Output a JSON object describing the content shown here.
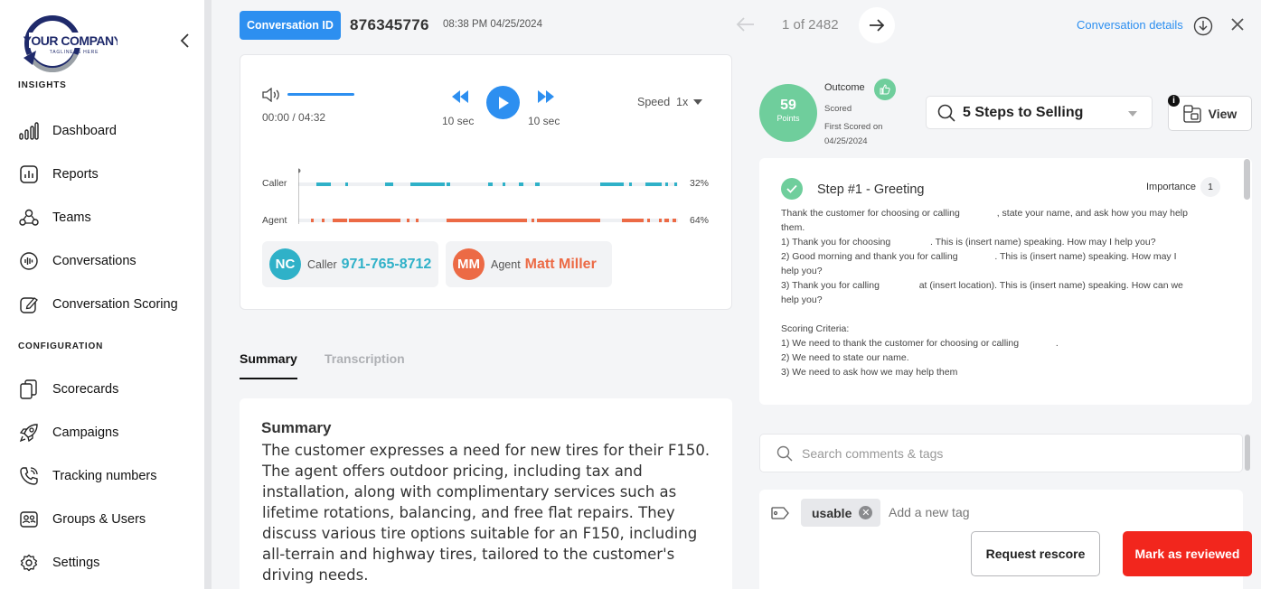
{
  "brand": {
    "logo_text": "YOUR COMPANY",
    "logo_tagline": "TAGLINE IS HERE"
  },
  "sidebar": {
    "sections": [
      {
        "label": "INSIGHTS",
        "items": [
          {
            "label": "Dashboard",
            "icon": "bar-chart-icon"
          },
          {
            "label": "Reports",
            "icon": "report-icon"
          },
          {
            "label": "Teams",
            "icon": "teams-icon"
          },
          {
            "label": "Conversations",
            "icon": "waveform-icon"
          },
          {
            "label": "Conversation Scoring",
            "icon": "edit-score-icon"
          }
        ]
      },
      {
        "label": "CONFIGURATION",
        "items": [
          {
            "label": "Scorecards",
            "icon": "cards-icon"
          },
          {
            "label": "Campaigns",
            "icon": "rocket-icon"
          },
          {
            "label": "Tracking numbers",
            "icon": "phone-icon"
          },
          {
            "label": "Groups & Users",
            "icon": "user-card-icon"
          },
          {
            "label": "Settings",
            "icon": "gear-icon"
          }
        ]
      }
    ]
  },
  "header": {
    "conversation_id_label": "Conversation ID",
    "conversation_id": "876345776",
    "timestamp": "08:38 PM 04/25/2024",
    "pager": "1 of 2482",
    "details_link": "Conversation details"
  },
  "player": {
    "time": "00:00 / 04:32",
    "rewind_label": "10 sec",
    "forward_label": "10 sec",
    "speed_label": "Speed",
    "speed_value": "1x",
    "tracks": [
      {
        "name": "Caller",
        "pct": "32%",
        "color": "#2fb1c8"
      },
      {
        "name": "Agent",
        "pct": "64%",
        "color": "#ec6a45"
      }
    ],
    "caller": {
      "initials": "NC",
      "role": "Caller",
      "value": "971-765-8712",
      "color": "#2fb1c8"
    },
    "agent": {
      "initials": "MM",
      "role": "Agent",
      "value": "Matt Miller",
      "color": "#ec6a45"
    }
  },
  "tabs": [
    {
      "label": "Summary",
      "active": true
    },
    {
      "label": "Transcription",
      "active": false
    }
  ],
  "summary": {
    "heading": "Summary",
    "body": "The customer expresses a need for new tires for their F150. The agent offers outdoor pricing, including tax and installation, along with complimentary services such as lifetime rotations, balancing, and free flat repairs. They discuss various tire options suitable for an F150, including all-terrain and highway tires, tailored to the customer's driving needs."
  },
  "score": {
    "value": "59",
    "unit": "Points",
    "outcome_label": "Outcome",
    "status": "Scored",
    "first_scored_label": "First Scored on",
    "first_scored_date": "04/25/2024",
    "color": "#6fce9c"
  },
  "scorecard_select": {
    "value": "5 Steps to Selling"
  },
  "view_button": "View",
  "step": {
    "title": "Step #1 - Greeting",
    "importance_label": "Importance",
    "importance_value": "1",
    "lines": [
      "Thank the customer for choosing or calling              , state your name, and ask how you may help",
      "them.",
      "1) Thank you for choosing               . This is (insert name) speaking. How may I help you?",
      "2) Good morning and thank you for calling              . This is (insert name) speaking. How may I",
      "help you?",
      "3) Thank you for calling               at (insert location). This is (insert name) speaking. How can we",
      "help you?",
      "",
      "Scoring Criteria:",
      "1) We need to thank the customer for choosing or calling              .",
      "2) We need to state our name.",
      "3) We need to ask how we may help them"
    ]
  },
  "comments": {
    "search_placeholder": "Search comments & tags",
    "tags": [
      "usable"
    ],
    "add_tag_placeholder": "Add a new tag"
  },
  "actions": {
    "rescore": "Request rescore",
    "reviewed": "Mark as reviewed"
  }
}
